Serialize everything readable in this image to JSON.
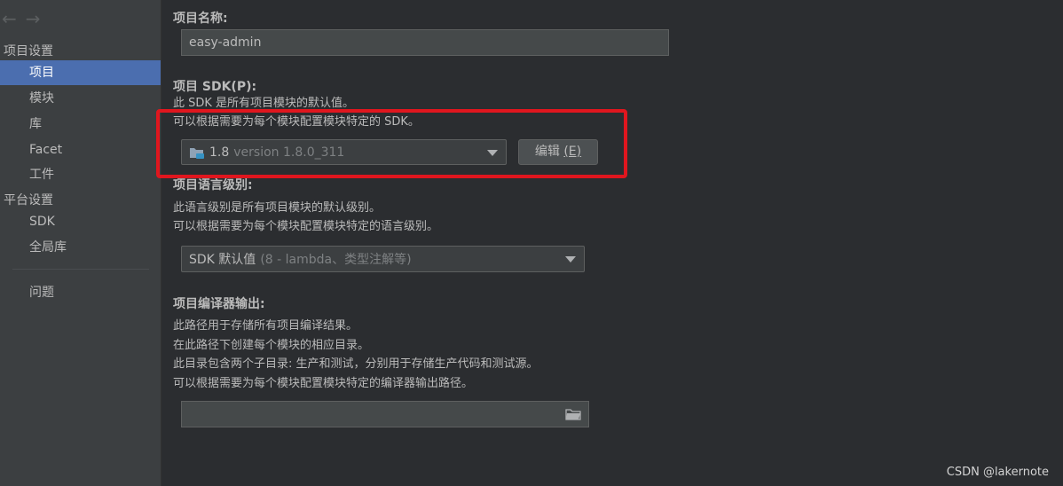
{
  "sidebar": {
    "back_arrow": "←",
    "forward_arrow": "→",
    "project_settings_header": "项目设置",
    "project_items": [
      "项目",
      "模块",
      "库",
      "Facet",
      "工件"
    ],
    "platform_settings_header": "平台设置",
    "platform_items": [
      "SDK",
      "全局库"
    ],
    "problems": "问题"
  },
  "project_name": {
    "label": "项目名称:",
    "value": "easy-admin"
  },
  "sdk": {
    "label": "项目 SDK(P):",
    "desc_line1": "此 SDK 是所有项目模块的默认值。",
    "desc_line2": "可以根据需要为每个模块配置模块特定的 SDK。",
    "combo_main": "1.8",
    "combo_gray": "version 1.8.0_311",
    "edit_button": "编辑",
    "edit_mnemonic": "(E)"
  },
  "language_level": {
    "label": "项目语言级别:",
    "desc_line1": "此语言级别是所有项目模块的默认级别。",
    "desc_line2": "可以根据需要为每个模块配置模块特定的语言级别。",
    "combo_main": "SDK 默认值",
    "combo_gray": "(8 - lambda、类型注解等)"
  },
  "compiler_output": {
    "label": "项目编译器输出:",
    "desc_line1": "此路径用于存储所有项目编译结果。",
    "desc_line2": "在此路径下创建每个模块的相应目录。",
    "desc_line3": "此目录包含两个子目录: 生产和测试，分别用于存储生产代码和测试源。",
    "desc_line4": "可以根据需要为每个模块配置模块特定的编译器输出路径。",
    "path_value": ""
  },
  "watermark": "CSDN @lakernote",
  "colors": {
    "selection": "#4b6eaf",
    "highlight_box": "#e0161e",
    "background": "#2b2d30",
    "sidebar": "#3c3f41"
  }
}
